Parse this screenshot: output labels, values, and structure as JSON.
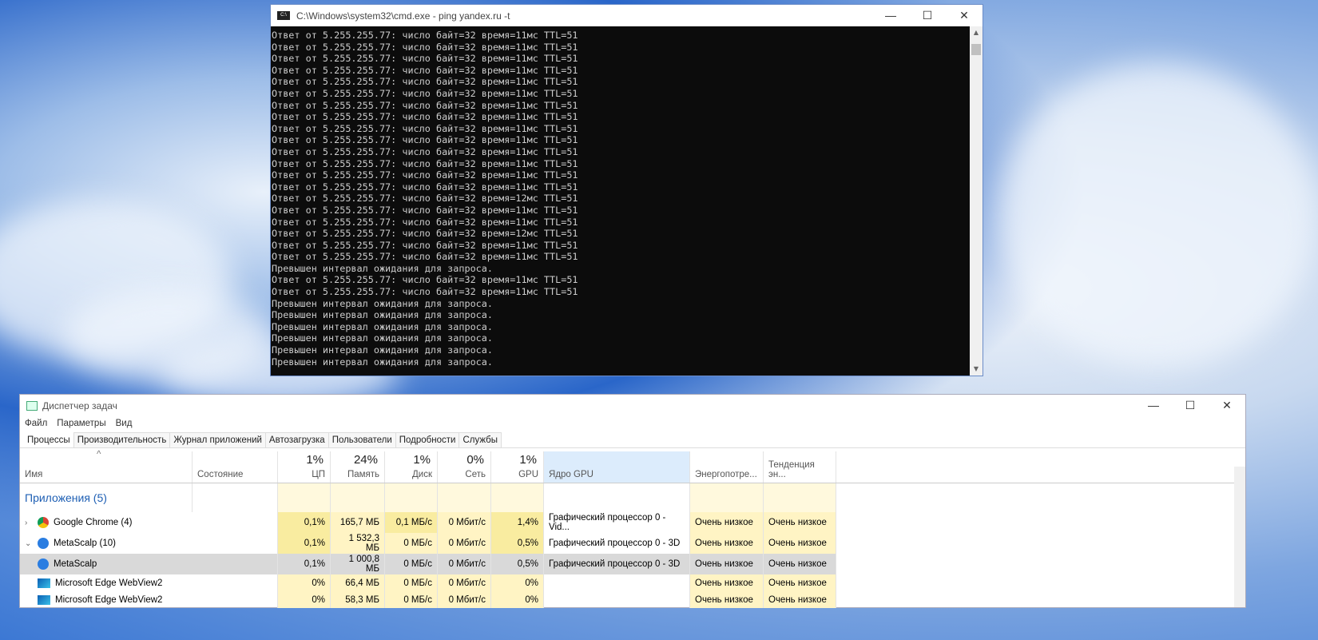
{
  "cmd": {
    "title": "C:\\Windows\\system32\\cmd.exe - ping  yandex.ru -t",
    "lines": [
      "Ответ от 5.255.255.77: число байт=32 время=11мс TTL=51",
      "Ответ от 5.255.255.77: число байт=32 время=11мс TTL=51",
      "Ответ от 5.255.255.77: число байт=32 время=11мс TTL=51",
      "Ответ от 5.255.255.77: число байт=32 время=11мс TTL=51",
      "Ответ от 5.255.255.77: число байт=32 время=11мс TTL=51",
      "Ответ от 5.255.255.77: число байт=32 время=11мс TTL=51",
      "Ответ от 5.255.255.77: число байт=32 время=11мс TTL=51",
      "Ответ от 5.255.255.77: число байт=32 время=11мс TTL=51",
      "Ответ от 5.255.255.77: число байт=32 время=11мс TTL=51",
      "Ответ от 5.255.255.77: число байт=32 время=11мс TTL=51",
      "Ответ от 5.255.255.77: число байт=32 время=11мс TTL=51",
      "Ответ от 5.255.255.77: число байт=32 время=11мс TTL=51",
      "Ответ от 5.255.255.77: число байт=32 время=11мс TTL=51",
      "Ответ от 5.255.255.77: число байт=32 время=11мс TTL=51",
      "Ответ от 5.255.255.77: число байт=32 время=12мс TTL=51",
      "Ответ от 5.255.255.77: число байт=32 время=11мс TTL=51",
      "Ответ от 5.255.255.77: число байт=32 время=11мс TTL=51",
      "Ответ от 5.255.255.77: число байт=32 время=12мс TTL=51",
      "Ответ от 5.255.255.77: число байт=32 время=11мс TTL=51",
      "Ответ от 5.255.255.77: число байт=32 время=11мс TTL=51",
      "Превышен интервал ожидания для запроса.",
      "Ответ от 5.255.255.77: число байт=32 время=11мс TTL=51",
      "Ответ от 5.255.255.77: число байт=32 время=11мс TTL=51",
      "Превышен интервал ожидания для запроса.",
      "Превышен интервал ожидания для запроса.",
      "Превышен интервал ожидания для запроса.",
      "Превышен интервал ожидания для запроса.",
      "Превышен интервал ожидания для запроса.",
      "Превышен интервал ожидания для запроса."
    ]
  },
  "tm": {
    "title": "Диспетчер задач",
    "menu": [
      "Файл",
      "Параметры",
      "Вид"
    ],
    "tabs": [
      "Процессы",
      "Производительность",
      "Журнал приложений",
      "Автозагрузка",
      "Пользователи",
      "Подробности",
      "Службы"
    ],
    "headers": {
      "name": "Имя",
      "status": "Состояние",
      "cpu_pct": "1%",
      "cpu": "ЦП",
      "mem_pct": "24%",
      "mem": "Память",
      "disk_pct": "1%",
      "disk": "Диск",
      "net_pct": "0%",
      "net": "Сеть",
      "gpu_pct": "1%",
      "gpu": "GPU",
      "gpu_engine": "Ядро GPU",
      "power": "Энергопотре...",
      "power_trend": "Тенденция эн..."
    },
    "group": "Приложения (5)",
    "rows": [
      {
        "name": "Google Chrome (4)",
        "cpu": "0,1%",
        "mem": "165,7 МБ",
        "disk": "0,1 МБ/с",
        "net": "0 Мбит/с",
        "gpu": "1,4%",
        "engine": "Графический процессор 0 - Vid...",
        "power": "Очень низкое",
        "trend": "Очень низкое"
      },
      {
        "name": "MetaScalp (10)",
        "cpu": "0,1%",
        "mem": "1 532,3 МБ",
        "disk": "0 МБ/с",
        "net": "0 Мбит/с",
        "gpu": "0,5%",
        "engine": "Графический процессор 0 - 3D",
        "power": "Очень низкое",
        "trend": "Очень низкое"
      },
      {
        "name": "MetaScalp",
        "cpu": "0,1%",
        "mem": "1 000,8 МБ",
        "disk": "0 МБ/с",
        "net": "0 Мбит/с",
        "gpu": "0,5%",
        "engine": "Графический процессор 0 - 3D",
        "power": "Очень низкое",
        "trend": "Очень низкое"
      },
      {
        "name": "Microsoft Edge WebView2",
        "cpu": "0%",
        "mem": "66,4 МБ",
        "disk": "0 МБ/с",
        "net": "0 Мбит/с",
        "gpu": "0%",
        "engine": "",
        "power": "Очень низкое",
        "trend": "Очень низкое"
      },
      {
        "name": "Microsoft Edge WebView2",
        "cpu": "0%",
        "mem": "58,3 МБ",
        "disk": "0 МБ/с",
        "net": "0 Мбит/с",
        "gpu": "0%",
        "engine": "",
        "power": "Очень низкое",
        "trend": "Очень низкое"
      }
    ]
  }
}
